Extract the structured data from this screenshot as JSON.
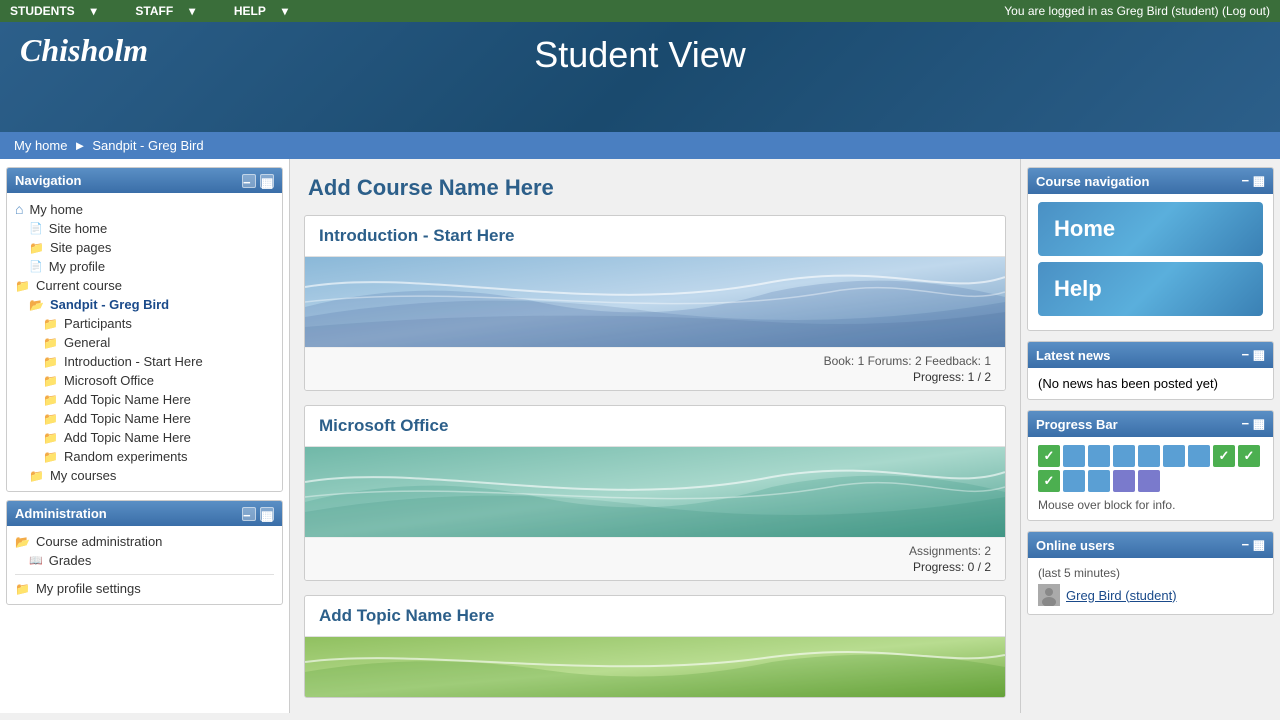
{
  "topbar": {
    "nav_items": [
      "STUDENTS",
      "STAFF",
      "HELP"
    ],
    "login_status": "You are logged in as Greg Bird (student) (Log out)",
    "dropdown_arrow": "▾"
  },
  "header": {
    "logo_text": "Chisholm",
    "student_view_title": "Student View"
  },
  "breadcrumb": {
    "my_home": "My home",
    "separator": "►",
    "current": "Sandpit - Greg Bird"
  },
  "navigation_block": {
    "title": "Navigation",
    "items": [
      {
        "label": "My home",
        "icon": "home",
        "indent": 0
      },
      {
        "label": "Site home",
        "icon": "page",
        "indent": 1
      },
      {
        "label": "Site pages",
        "icon": "folder",
        "indent": 1
      },
      {
        "label": "My profile",
        "icon": "page",
        "indent": 1
      },
      {
        "label": "Current course",
        "icon": "folder",
        "indent": 0
      },
      {
        "label": "Sandpit - Greg Bird",
        "icon": "folder-open",
        "indent": 1,
        "active": true
      },
      {
        "label": "Participants",
        "icon": "folder",
        "indent": 2
      },
      {
        "label": "General",
        "icon": "folder",
        "indent": 2
      },
      {
        "label": "Introduction - Start Here",
        "icon": "folder",
        "indent": 2
      },
      {
        "label": "Microsoft Office",
        "icon": "folder",
        "indent": 2
      },
      {
        "label": "Add Topic Name Here",
        "icon": "folder",
        "indent": 2
      },
      {
        "label": "Add Topic Name Here",
        "icon": "folder",
        "indent": 2
      },
      {
        "label": "Add Topic Name Here",
        "icon": "folder",
        "indent": 2
      },
      {
        "label": "Random experiments",
        "icon": "folder",
        "indent": 2
      },
      {
        "label": "My courses",
        "icon": "folder",
        "indent": 1
      }
    ]
  },
  "administration_block": {
    "title": "Administration",
    "items": [
      {
        "label": "Course administration",
        "icon": "folder",
        "indent": 0
      },
      {
        "label": "Grades",
        "icon": "book",
        "indent": 1
      },
      {
        "label": "My profile settings",
        "icon": "folder",
        "indent": 0
      }
    ]
  },
  "course": {
    "title": "Add Course Name Here",
    "topics": [
      {
        "id": "topic1",
        "title": "Introduction - Start Here",
        "banner_class": "banner-blue",
        "stats": "Book: 1  Forums: 2  Feedback: 1",
        "progress": "Progress: 1 / 2"
      },
      {
        "id": "topic2",
        "title": "Microsoft Office",
        "banner_class": "banner-teal",
        "stats": "Assignments: 2",
        "progress": "Progress: 0 / 2"
      },
      {
        "id": "topic3",
        "title": "Add Topic Name Here",
        "banner_class": "banner-green",
        "stats": "",
        "progress": ""
      }
    ]
  },
  "course_navigation_block": {
    "title": "Course navigation",
    "buttons": [
      {
        "label": "Home",
        "class": "btn-home"
      },
      {
        "label": "Help",
        "class": "btn-help"
      }
    ]
  },
  "latest_news_block": {
    "title": "Latest news",
    "content": "(No news has been posted yet)"
  },
  "progress_bar_block": {
    "title": "Progress Bar",
    "hint": "Mouse over block for info.",
    "blocks": [
      {
        "type": "check-green"
      },
      {
        "type": "blue"
      },
      {
        "type": "blue"
      },
      {
        "type": "blue"
      },
      {
        "type": "blue"
      },
      {
        "type": "blue"
      },
      {
        "type": "blue"
      },
      {
        "type": "check-green"
      },
      {
        "type": "check-green"
      },
      {
        "type": "check-green"
      },
      {
        "type": "blue"
      },
      {
        "type": "blue"
      },
      {
        "type": "purple"
      },
      {
        "type": "purple"
      }
    ]
  },
  "online_users_block": {
    "title": "Online users",
    "subtitle": "(last 5 minutes)",
    "users": [
      {
        "name": "Greg Bird (student)",
        "avatar": "GB"
      }
    ]
  },
  "icons": {
    "home": "⌂",
    "folder": "📁",
    "folder-open": "📂",
    "page": "📄",
    "book": "📖",
    "check": "✓",
    "minus": "−",
    "grid": "▦"
  }
}
